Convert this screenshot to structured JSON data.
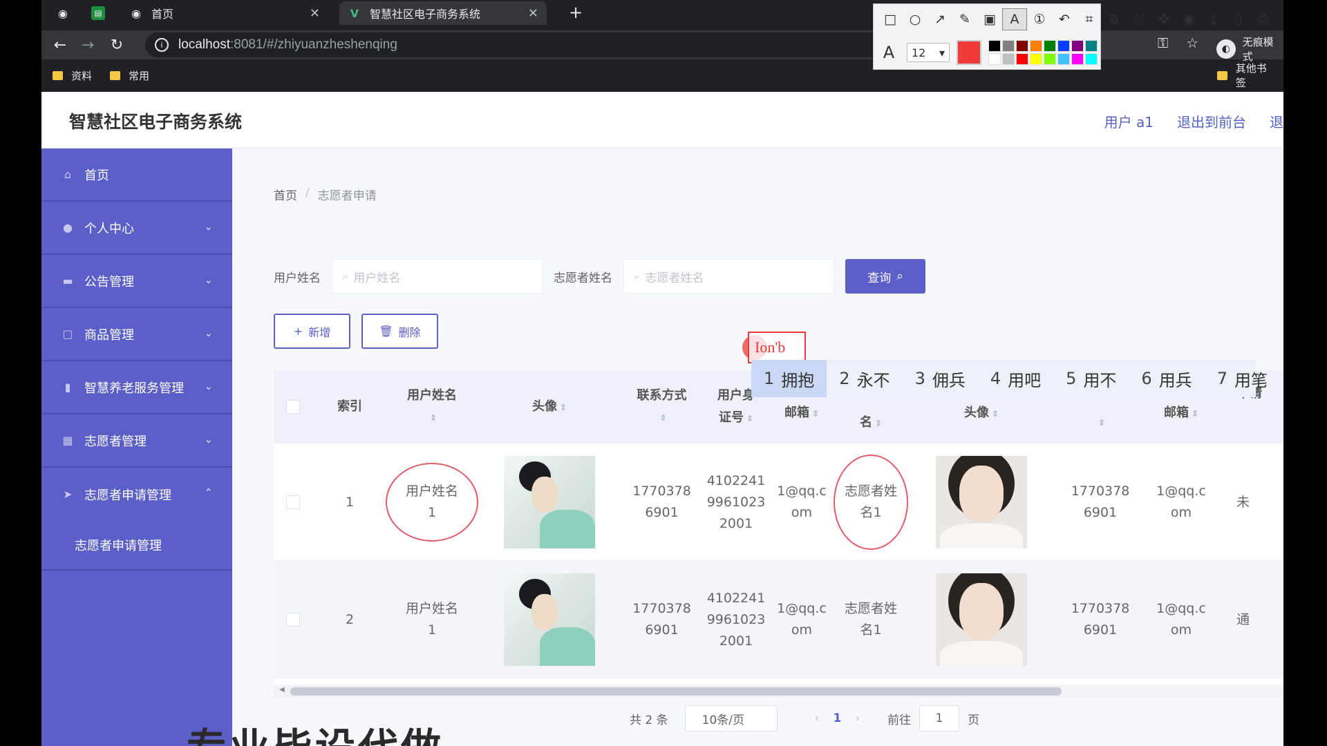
{
  "browser": {
    "tabs": [
      {
        "title": "首页"
      },
      {
        "title": "智慧社区电子商务系统"
      }
    ],
    "url_host": "localhost",
    "url_path": ":8081/#/zhiyuanzheshenqing",
    "bookmarks": [
      "资料",
      "常用"
    ],
    "other_bookmarks": "其他书签",
    "profile": "无痕模式"
  },
  "screenshot_tool": {
    "font_size": "12",
    "current_color": "#f23c3c",
    "palette": [
      "#000000",
      "#808080",
      "#800000",
      "#ff8000",
      "#008000",
      "#0040ff",
      "#800080",
      "#008080",
      "#ffffff",
      "#c0c0c0",
      "#ff0000",
      "#ffff00",
      "#80ff00",
      "#40c0ff",
      "#ff00ff",
      "#00ffff"
    ]
  },
  "app": {
    "title": "智慧社区电子商务系统",
    "header_links": [
      "用户 a1",
      "退出到前台",
      "退"
    ]
  },
  "sidebar": {
    "items": [
      {
        "label": "首页",
        "icon": "home-icon",
        "arrow": ""
      },
      {
        "label": "个人中心",
        "icon": "user-icon",
        "arrow": "⌄"
      },
      {
        "label": "公告管理",
        "icon": "notice-icon",
        "arrow": "⌄"
      },
      {
        "label": "商品管理",
        "icon": "goods-icon",
        "arrow": "⌄"
      },
      {
        "label": "智慧养老服务管理",
        "icon": "service-icon",
        "arrow": "⌄"
      },
      {
        "label": "志愿者管理",
        "icon": "grid-icon",
        "arrow": "⌄"
      },
      {
        "label": "志愿者申请管理",
        "icon": "send-icon",
        "arrow": "⌃"
      }
    ],
    "submenu": "志愿者申请管理"
  },
  "breadcrumb": {
    "home": "首页",
    "sep": "/",
    "current": "志愿者申请"
  },
  "search": {
    "user_label": "用户姓名",
    "user_placeholder": "用户姓名",
    "volunteer_label": "志愿者姓名",
    "volunteer_placeholder": "志愿者姓名",
    "query_button": "查询"
  },
  "actions": {
    "add": "新增",
    "delete": "删除"
  },
  "table": {
    "headers": {
      "index": "索引",
      "user_name": [
        "用户姓名"
      ],
      "avatar": "头像",
      "contact": "联系方式",
      "id_card": [
        "用户身",
        "证号"
      ],
      "email": "邮箱",
      "vol_name": "名",
      "vol_avatar": "头像",
      "vol_contact": "",
      "vol_email": "邮箱",
      "apply": "申请"
    },
    "rows": [
      {
        "index": "1",
        "user_name": [
          "用户姓名",
          "1"
        ],
        "contact": [
          "1770378",
          "6901"
        ],
        "id_card": [
          "4102241",
          "9961023",
          "2001"
        ],
        "email": [
          "1@qq.c",
          "om"
        ],
        "vol_name": [
          "志愿者姓",
          "名1"
        ],
        "vol_contact": [
          "1770378",
          "6901"
        ],
        "vol_email": [
          "1@qq.c",
          "om"
        ],
        "apply": "未"
      },
      {
        "index": "2",
        "user_name": [
          "用户姓名",
          "1"
        ],
        "contact": [
          "1770378",
          "6901"
        ],
        "id_card": [
          "4102241",
          "9961023",
          "2001"
        ],
        "email": [
          "1@qq.c",
          "om"
        ],
        "vol_name": [
          "志愿者姓",
          "名1"
        ],
        "vol_contact": [
          "1770378",
          "6901"
        ],
        "vol_email": [
          "1@qq.c",
          "om"
        ],
        "apply": "通"
      }
    ]
  },
  "pagination": {
    "total": "共 2 条",
    "page_size": "10条/页",
    "current_page": "1",
    "goto_label": "前往",
    "goto_value": "1",
    "page_suffix": "页"
  },
  "ime": {
    "composition": "Ion'b",
    "candidates": [
      {
        "n": "1",
        "text": "拥抱"
      },
      {
        "n": "2",
        "text": "永不"
      },
      {
        "n": "3",
        "text": "佣兵"
      },
      {
        "n": "4",
        "text": "用吧"
      },
      {
        "n": "5",
        "text": "用不"
      },
      {
        "n": "6",
        "text": "用兵"
      },
      {
        "n": "7",
        "text": "用笔"
      }
    ]
  },
  "overlay_caption": "专业毕设代做"
}
